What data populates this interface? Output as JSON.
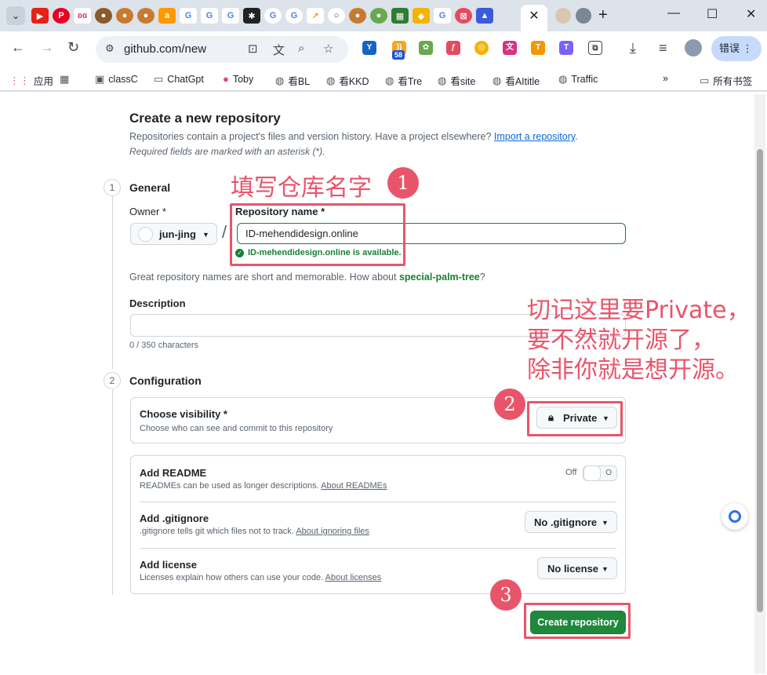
{
  "browser": {
    "url": "github.com/new",
    "error_label": "错误",
    "ext_badge": "58",
    "bookmarks": [
      {
        "label": "应用"
      },
      {
        "label": ""
      },
      {
        "label": "classC"
      },
      {
        "label": "ChatGpt"
      },
      {
        "label": "Toby"
      },
      {
        "label": "看BL"
      },
      {
        "label": "看KKD"
      },
      {
        "label": "看Tre"
      },
      {
        "label": "看site"
      },
      {
        "label": "看AItitle"
      },
      {
        "label": "Traffic"
      }
    ],
    "all_bookmarks": "所有书签"
  },
  "page": {
    "title": "Create a new repository",
    "subtitle_text": "Repositories contain a project's files and version history. Have a project elsewhere?",
    "import_link": "Import a repository",
    "subtitle_end": ".",
    "required_note": "Required fields are marked with an asterisk (*).",
    "steps": [
      {
        "number": "1",
        "title": "General"
      },
      {
        "number": "2",
        "title": "Configuration"
      }
    ],
    "owner_label": "Owner *",
    "owner_value": "jun-jing",
    "slash": "/",
    "repo_name_label": "Repository name *",
    "repo_name_value": "ID-mehendidesign.online",
    "availability": "ID-mehendidesign.online is available.",
    "suggest_text": "Great repository names are short and memorable. How about",
    "suggest_name": "special-palm-tree",
    "suggest_end": "?",
    "description_label": "Description",
    "description_value": "",
    "char_count": "0 / 350 characters",
    "visibility": {
      "title": "Choose visibility *",
      "desc": "Choose who can see and commit to this repository",
      "value": "Private"
    },
    "readme": {
      "title": "Add README",
      "desc": "READMEs can be used as longer descriptions.",
      "link": "About READMEs",
      "toggle_label": "Off"
    },
    "gitignore": {
      "title": "Add .gitignore",
      "desc": ".gitignore tells git which files not to track.",
      "link": "About ignoring files",
      "value": "No .gitignore"
    },
    "license": {
      "title": "Add license",
      "desc": "Licenses explain how others can use your code.",
      "link": "About licenses",
      "value": "No license"
    },
    "create_button": "Create repository"
  },
  "annotations": {
    "marker_1": "1",
    "marker_2": "2",
    "marker_3": "3",
    "note_1": "填写仓库名字",
    "note_2": [
      "切记这里要Private，",
      "要不然就开源了，",
      "除非你就是想开源。"
    ],
    "color": "#e8556a"
  },
  "colors": {
    "accent_green": "#1f883d",
    "link_blue": "#0969da",
    "annotation_red": "#e8556a"
  }
}
